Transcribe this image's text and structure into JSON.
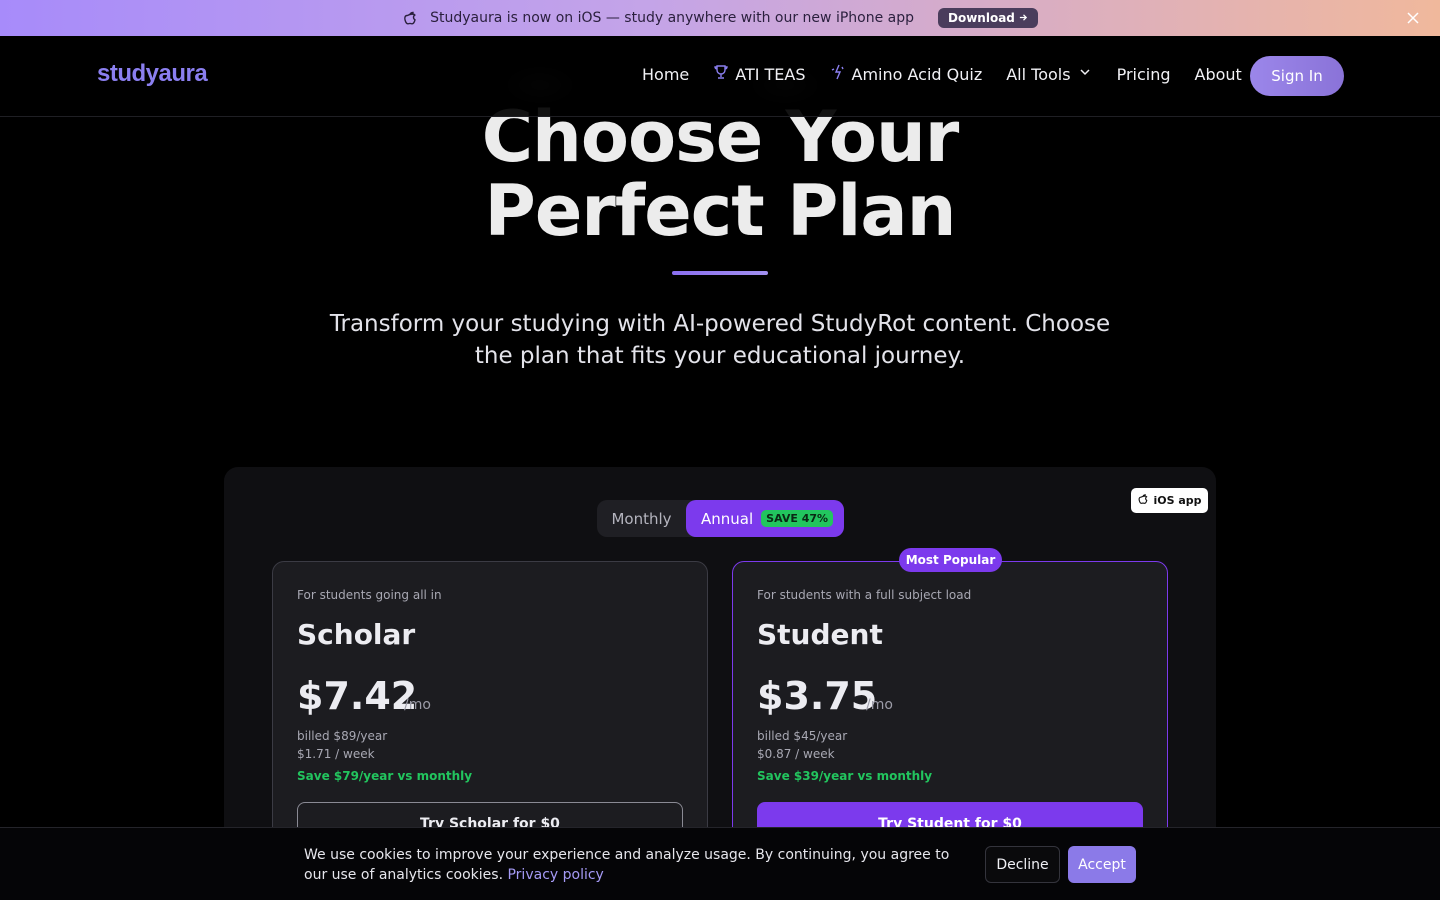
{
  "banner": {
    "message": "Studyaura is now on iOS — study anywhere with our new iPhone app",
    "download_label": "Download",
    "icon": "apple-icon"
  },
  "nav": {
    "logo": "studyaura",
    "links": [
      {
        "label": "Home"
      },
      {
        "label": "ATI TEAS",
        "icon": "trophy-icon"
      },
      {
        "label": "Amino Acid Quiz",
        "icon": "sparkle-icon"
      },
      {
        "label": "All Tools",
        "icon": "chevron-down-icon"
      },
      {
        "label": "Pricing"
      },
      {
        "label": "About"
      }
    ],
    "signin": "Sign In"
  },
  "hero": {
    "title_line1": "Choose Your",
    "title_line2": "Perfect Plan",
    "subtitle": "Transform your studying with AI-powered StudyRot content. Choose the plan that fits your educational journey."
  },
  "pricing": {
    "ios_badge": "iOS app",
    "toggle": {
      "monthly": "Monthly",
      "annual": "Annual",
      "save": "SAVE 47%",
      "selected": "Annual"
    },
    "popular_badge": "Most Popular",
    "plans": [
      {
        "tag": "For students going all in",
        "name": "Scholar",
        "price": "$7.42",
        "per": "/mo",
        "billed": "billed $89/year",
        "weekly": "$1.71 / week",
        "save": "Save $79/year vs monthly",
        "cta": "Try Scholar for $0"
      },
      {
        "tag": "For students with a full subject load",
        "name": "Student",
        "price": "$3.75",
        "per": "/mo",
        "billed": "billed $45/year",
        "weekly": "$0.87 / week",
        "save": "Save $39/year vs monthly",
        "cta": "Try Student for $0"
      }
    ]
  },
  "cookie": {
    "message": "We use cookies to improve your experience and analyze usage. By continuing, you agree to our use of analytics cookies.",
    "privacy_link": "Privacy policy",
    "decline": "Decline",
    "accept": "Accept"
  },
  "colors": {
    "accent": "#7c3aed",
    "logo": "#8b7ff0",
    "success": "#22c55e"
  }
}
